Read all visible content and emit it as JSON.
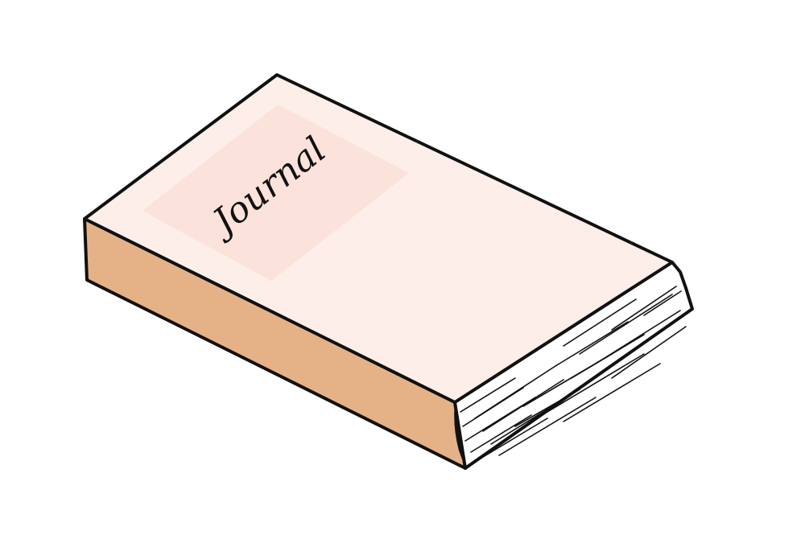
{
  "illustration": {
    "subject": "closed-book",
    "cover_label": "Journal",
    "colors": {
      "background": "#ffffff",
      "cover": "#fdeee9",
      "label_panel": "#fbe2da",
      "spine": "#e5b287",
      "pages": "#ffffff",
      "outline": "#111111"
    }
  }
}
